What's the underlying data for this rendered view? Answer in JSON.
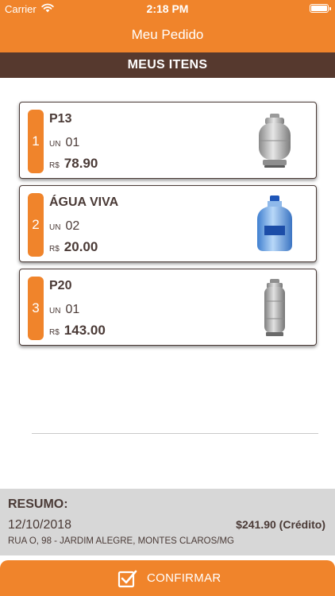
{
  "status_bar": {
    "carrier": "Carrier",
    "time": "2:18 PM"
  },
  "nav": {
    "title": "Meu Pedido"
  },
  "section": {
    "title": "MEUS ITENS"
  },
  "items": [
    {
      "index": "1",
      "name": "P13",
      "qty_prefix": "UN",
      "qty": "01",
      "price_prefix": "R$",
      "price": "78.90",
      "image": "gas-cylinder-p13"
    },
    {
      "index": "2",
      "name": "ÁGUA VIVA",
      "qty_prefix": "UN",
      "qty": "02",
      "price_prefix": "R$",
      "price": "20.00",
      "image": "water-jug"
    },
    {
      "index": "3",
      "name": "P20",
      "qty_prefix": "UN",
      "qty": "01",
      "price_prefix": "R$",
      "price": "143.00",
      "image": "gas-cylinder-p20"
    }
  ],
  "summary": {
    "title": "RESUMO:",
    "date": "12/10/2018",
    "total": "$241.90 (Crédito)",
    "address": "RUA O, 98 - JARDIM ALEGRE, MONTES CLAROS/MG"
  },
  "confirm": {
    "label": "CONFIRMAR"
  },
  "colors": {
    "accent": "#f0842b",
    "header_brown": "#56392e",
    "text_brown": "#4a3a36",
    "summary_bg": "#d7d7d7"
  }
}
